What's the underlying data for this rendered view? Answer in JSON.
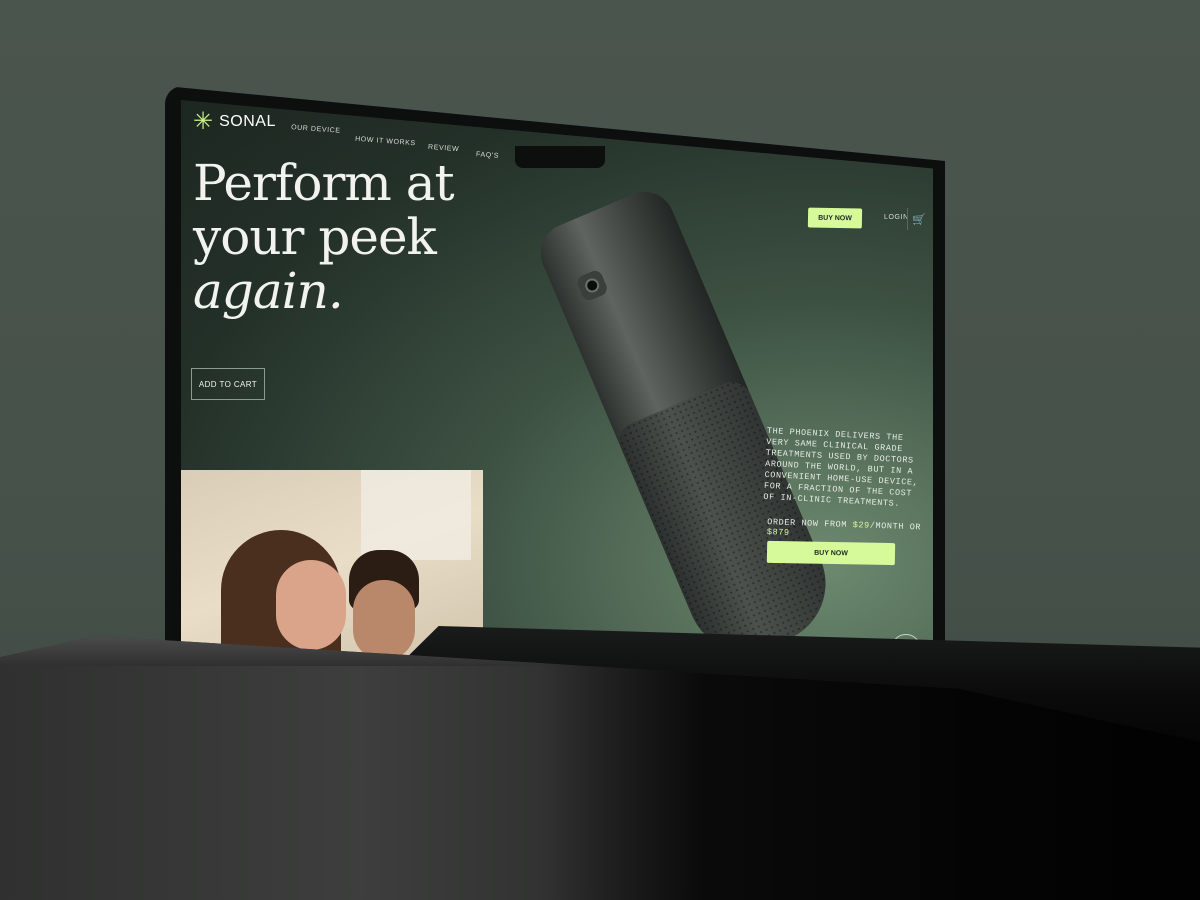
{
  "brand": {
    "name": "SONAL",
    "mark": "✳"
  },
  "nav": {
    "items": [
      "OUR DEVICE",
      "HOW IT WORKS",
      "REVIEW",
      "FAQ'S"
    ],
    "buy_now": "BUY NOW",
    "login": "LOGIN",
    "cart_icon": "🛒"
  },
  "hero": {
    "line1": "Perform at",
    "line2": "your peek",
    "line3": "again.",
    "add_to_cart": "ADD TO CART"
  },
  "product": {
    "description": "The Phoenix delivers the very same clinical grade treatments used by doctors around the world, but in a convenient home-use device, for a fraction of the cost of in-clinic treatments.",
    "order_prefix": "ORDER NOW FROM",
    "monthly_price": "$29",
    "order_mid": "/MONTH OR",
    "full_price": "$879",
    "buy_now": "BUY NOW",
    "scroll_icon": "↓"
  },
  "colors": {
    "accent": "#d6f99a",
    "background": "#4a554d",
    "screen": "#233028"
  }
}
